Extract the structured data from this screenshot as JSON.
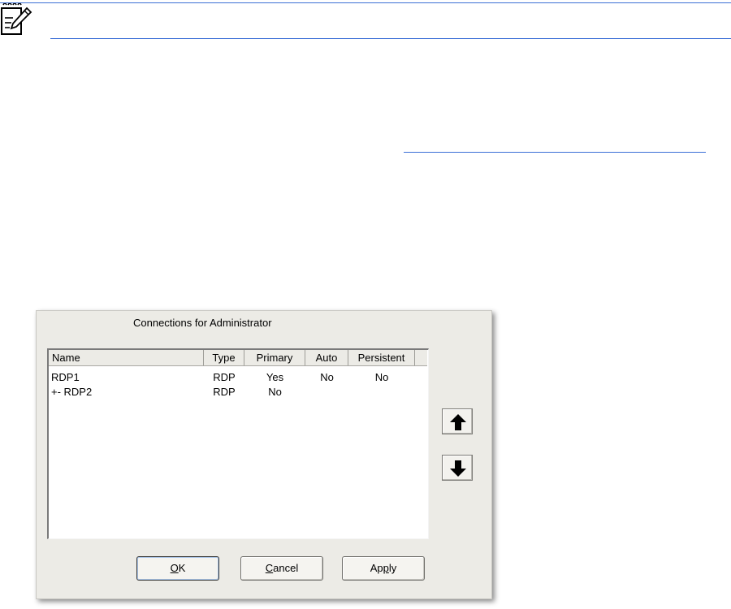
{
  "dialog": {
    "title": "Connections for Administrator",
    "columns": [
      "Name",
      "Type",
      "Primary",
      "Auto",
      "Persistent"
    ],
    "rows": [
      {
        "name": "RDP1",
        "type": "RDP",
        "primary": "Yes",
        "auto": "No",
        "persistent": "No"
      },
      {
        "name": "+- RDP2",
        "type": "RDP",
        "primary": "No",
        "auto": "",
        "persistent": ""
      }
    ],
    "buttons": {
      "ok": {
        "mnemonic": "O",
        "rest": "K"
      },
      "cancel": {
        "mnemonic": "C",
        "rest": "ancel"
      },
      "apply": {
        "pre": "Ap",
        "mnemonic": "p",
        "rest": "ly"
      }
    }
  },
  "icons": {
    "note": "note-pencil-icon",
    "move_up": "arrow-up-icon",
    "move_down": "arrow-down-icon"
  },
  "colors": {
    "rule": "#3b6fd6",
    "dialog_bg": "#ecebe6"
  }
}
